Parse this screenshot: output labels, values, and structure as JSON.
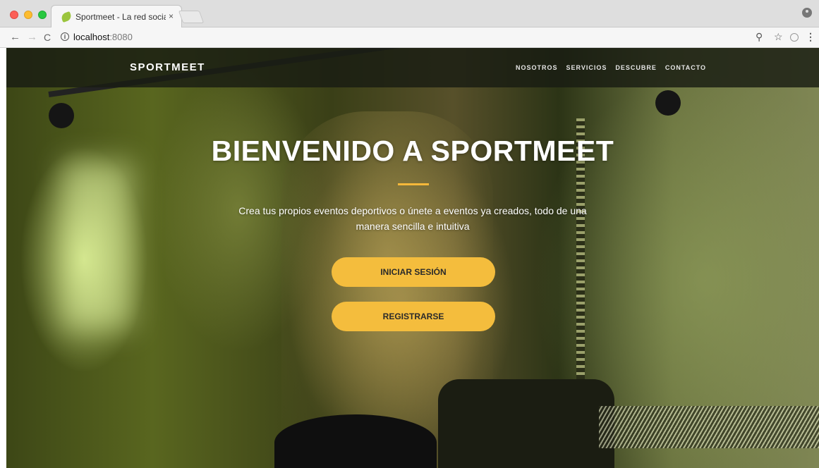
{
  "browser": {
    "tab_title": "Sportmeet - La red social depo",
    "tab_close": "×",
    "url_host": "localhost",
    "url_port": ":8080",
    "icons": {
      "back": "←",
      "forward": "→",
      "reload": "C",
      "info": "i",
      "zoom": "⚲",
      "star": "☆",
      "menu": "⋮"
    }
  },
  "site": {
    "brand": "SPORTMEET",
    "nav": [
      "NOSOTROS",
      "SERVICIOS",
      "DESCUBRE",
      "CONTACTO"
    ],
    "hero_title": "BIENVENIDO A SPORTMEET",
    "hero_subtitle": "Crea tus propios eventos deportivos o únete a eventos ya creados, todo de una manera sencilla e intuitiva",
    "login_button": "INICIAR SESIÓN",
    "register_button": "REGISTRARSE",
    "accent_color": "#f4bd3d"
  }
}
